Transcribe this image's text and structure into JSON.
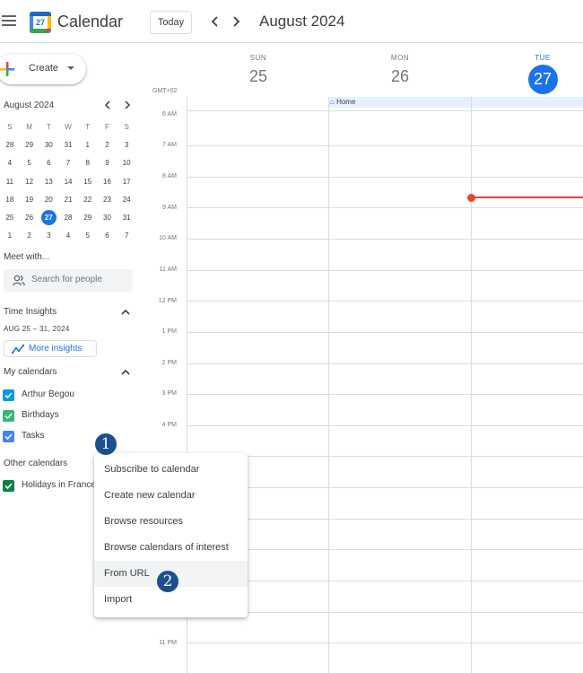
{
  "header": {
    "app_title": "Calendar",
    "logo_day": "27",
    "today_label": "Today",
    "prev_icon": "chevron-left-icon",
    "next_icon": "chevron-right-icon",
    "month_title": "August 2024"
  },
  "create": {
    "label": "Create"
  },
  "mini_calendar": {
    "title": "August 2024",
    "dow": [
      "S",
      "M",
      "T",
      "W",
      "T",
      "F",
      "S"
    ],
    "weeks": [
      [
        "28",
        "29",
        "30",
        "31",
        "1",
        "2",
        "3"
      ],
      [
        "4",
        "5",
        "6",
        "7",
        "8",
        "9",
        "10"
      ],
      [
        "11",
        "12",
        "13",
        "14",
        "15",
        "16",
        "17"
      ],
      [
        "18",
        "19",
        "20",
        "21",
        "22",
        "23",
        "24"
      ],
      [
        "25",
        "26",
        "27",
        "28",
        "29",
        "30",
        "31"
      ],
      [
        "1",
        "2",
        "3",
        "4",
        "5",
        "6",
        "7"
      ]
    ],
    "selected": "27"
  },
  "meet": {
    "title": "Meet with...",
    "placeholder": "Search for people"
  },
  "insights": {
    "title": "Time Insights",
    "range": "AUG 25 – 31, 2024",
    "button": "More insights"
  },
  "my_calendars": {
    "title": "My calendars",
    "items": [
      {
        "label": "Arthur Begou",
        "color": "#039be5"
      },
      {
        "label": "Birthdays",
        "color": "#33b679"
      },
      {
        "label": "Tasks",
        "color": "#4285f4"
      }
    ]
  },
  "other_calendars": {
    "title": "Other calendars",
    "items": [
      {
        "label": "Holidays in France",
        "color": "#0b8043"
      }
    ]
  },
  "grid": {
    "timezone": "GMT+02",
    "days": [
      {
        "dow": "SUN",
        "num": "25"
      },
      {
        "dow": "MON",
        "num": "26"
      },
      {
        "dow": "TUE",
        "num": "27"
      }
    ],
    "hours": [
      "6 AM",
      "7 AM",
      "8 AM",
      "9 AM",
      "10 AM",
      "11 AM",
      "12 PM",
      "1 PM",
      "2 PM",
      "3 PM",
      "4 PM",
      "11 PM"
    ],
    "allday_event": "Home"
  },
  "menu": {
    "items": [
      "Subscribe to calendar",
      "Create new calendar",
      "Browse resources",
      "Browse calendars of interest",
      "From URL",
      "Import"
    ]
  },
  "badges": [
    "1",
    "2"
  ],
  "colors": {
    "accent": "#1a73e8",
    "now": "#ea4335",
    "badge": "#1b4f8f"
  }
}
